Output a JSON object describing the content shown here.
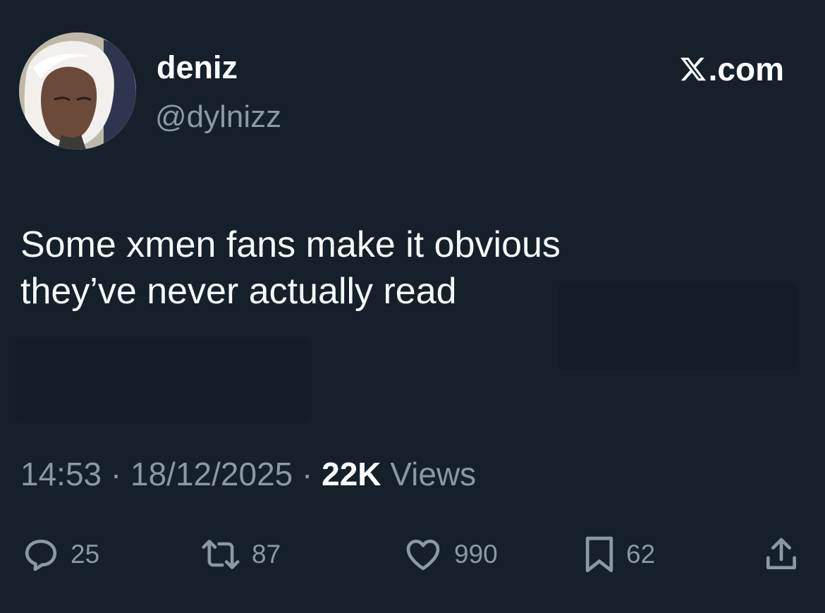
{
  "author": {
    "display_name": "deniz",
    "handle": "@dylnizz",
    "avatar_icon": "anime-avatar-icon"
  },
  "brand": {
    "text": ".com",
    "logo_icon": "x-logo-icon"
  },
  "tweet": {
    "lines": [
      "Some xmen fans make it obvious",
      "they’ve never actually read"
    ]
  },
  "meta": {
    "time": "14:53",
    "sep1": " · ",
    "date": "18/12/2025",
    "sep2": " · ",
    "views_count": "22K",
    "views_label": " Views"
  },
  "actions": {
    "reply": {
      "icon": "reply-icon",
      "count": "25"
    },
    "repost": {
      "icon": "repost-icon",
      "count": "87"
    },
    "like": {
      "icon": "heart-icon",
      "count": "990"
    },
    "bookmark": {
      "icon": "bookmark-icon",
      "count": "62"
    },
    "share": {
      "icon": "share-icon"
    }
  },
  "colors": {
    "background": "#15202b",
    "text_primary": "#f7f9f9",
    "text_secondary": "#8b98a5"
  }
}
